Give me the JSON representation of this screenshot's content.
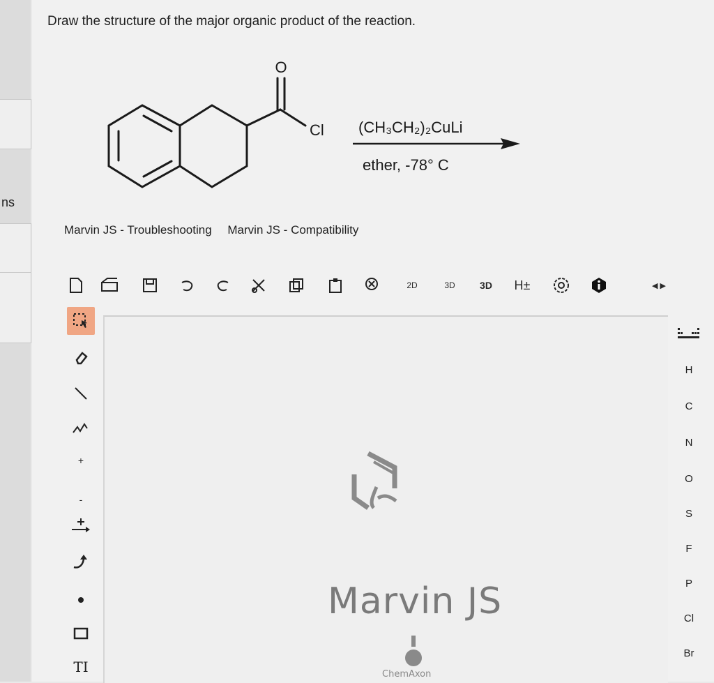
{
  "question": "Draw the structure of the major organic product of the reaction.",
  "side": {
    "label": "ns"
  },
  "reaction": {
    "carbonyl_O": "O",
    "chloride": "Cl",
    "reagent": "(CH₃CH₂)₂CuLi",
    "conditions": "ether, -78° C"
  },
  "links": [
    "Marvin JS - Troubleshooting",
    "Marvin JS - Compatibility"
  ],
  "toolbar": {
    "new": "new-document-icon",
    "clean2d": "2D",
    "clean3d": "3D",
    "view3d": "3D",
    "hydrogens": "H±"
  },
  "left_tools": {
    "text": "TI",
    "plus": "+",
    "minus": "-"
  },
  "atoms": [
    "H",
    "C",
    "N",
    "O",
    "S",
    "F",
    "P",
    "Cl",
    "Br"
  ],
  "canvas": {
    "logo_text": "Marvin JS",
    "brand": "ChemAxon"
  }
}
